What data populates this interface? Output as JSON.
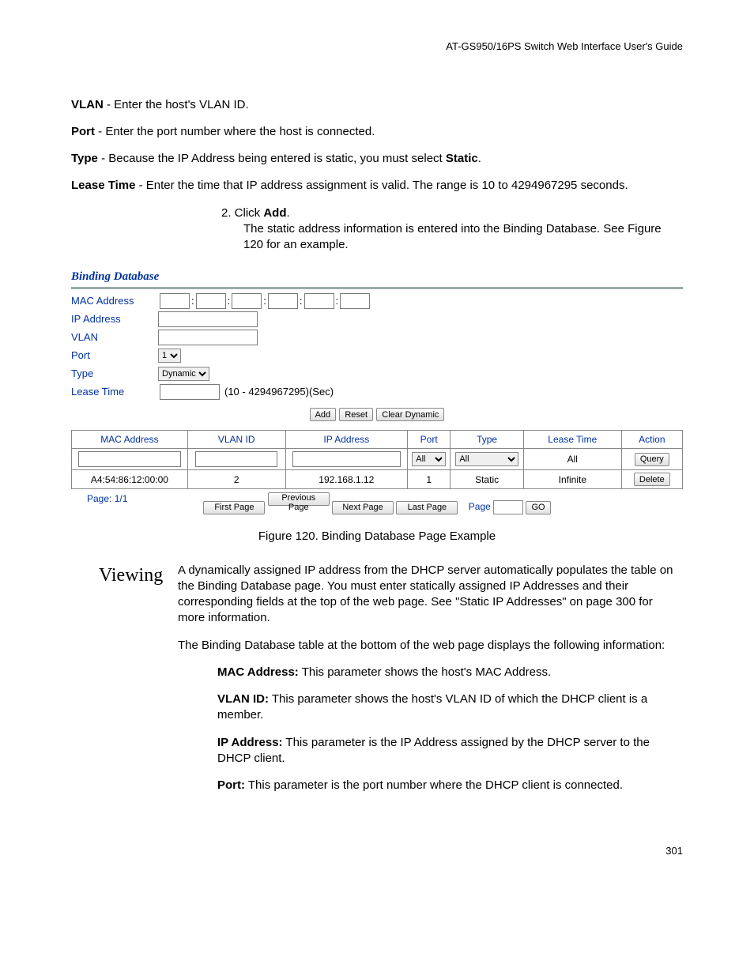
{
  "header": {
    "right": "AT-GS950/16PS Switch Web Interface User's Guide"
  },
  "defs": {
    "vlan": {
      "term": "VLAN",
      "text": " - Enter the host's VLAN ID."
    },
    "port": {
      "term": "Port",
      "text": " - Enter the port number where the host is connected."
    },
    "type": {
      "term": "Type",
      "text_a": " - Because the IP Address being entered is static, you must select ",
      "term2": "Static",
      "text_b": "."
    },
    "lease": {
      "term": "Lease Time",
      "text": " - Enter the time that IP address assignment is valid. The range is 10 to 4294967295 seconds."
    }
  },
  "step2": {
    "lead": "2.   Click ",
    "bold": "Add",
    "tail": ".",
    "line2": "The static address information is entered into the Binding Database. See Figure 120 for an example."
  },
  "figure": {
    "title": "Binding Database",
    "labels": {
      "mac": "MAC Address",
      "ip": "IP Address",
      "vlan": "VLAN",
      "port": "Port",
      "type": "Type",
      "lease": "Lease Time"
    },
    "port_sel": "1",
    "type_sel": "Dynamic",
    "lease_hint": "(10 - 4294967295)(Sec)",
    "buttons": {
      "add": "Add",
      "reset": "Reset",
      "clear": "Clear Dynamic"
    },
    "table": {
      "headers": [
        "MAC Address",
        "VLAN ID",
        "IP Address",
        "Port",
        "Type",
        "Lease Time",
        "Action"
      ],
      "filter": {
        "port": "All",
        "type": "All",
        "lease": "All",
        "action": "Query"
      },
      "rows": [
        {
          "mac": "A4:54:86:12:00:00",
          "vlan": "2",
          "ip": "192.168.1.12",
          "port": "1",
          "type": "Static",
          "lease": "Infinite",
          "action": "Delete"
        }
      ]
    },
    "pager": {
      "label": "Page: 1/1",
      "first": "First Page",
      "prev": "Previous Page",
      "next": "Next Page",
      "last": "Last Page",
      "page_lbl": "Page",
      "go": "GO"
    },
    "caption": "Figure 120. Binding Database Page Example"
  },
  "viewing": {
    "heading": "Viewing",
    "p1": "A dynamically assigned IP address from the DHCP server automatically populates the table on the Binding Database page. You must enter statically assigned IP Addresses and their corresponding fields at the top of the web page. See \"Static IP Addresses\" on page 300 for more information.",
    "p2": "The Binding Database table at the bottom of the web page displays the following information:",
    "items": {
      "mac": {
        "term": "MAC Address:",
        "text": " This parameter shows the host's MAC Address."
      },
      "vlan": {
        "term": "VLAN ID:",
        "text": " This parameter shows the host's VLAN ID of which the DHCP client is a member."
      },
      "ip": {
        "term": "IP Address:",
        "text": " This parameter is the IP Address assigned by the DHCP server to the DHCP client."
      },
      "port": {
        "term": "Port:",
        "text": " This parameter is the port number where the DHCP client is connected."
      }
    }
  },
  "footer": {
    "page": "301"
  }
}
